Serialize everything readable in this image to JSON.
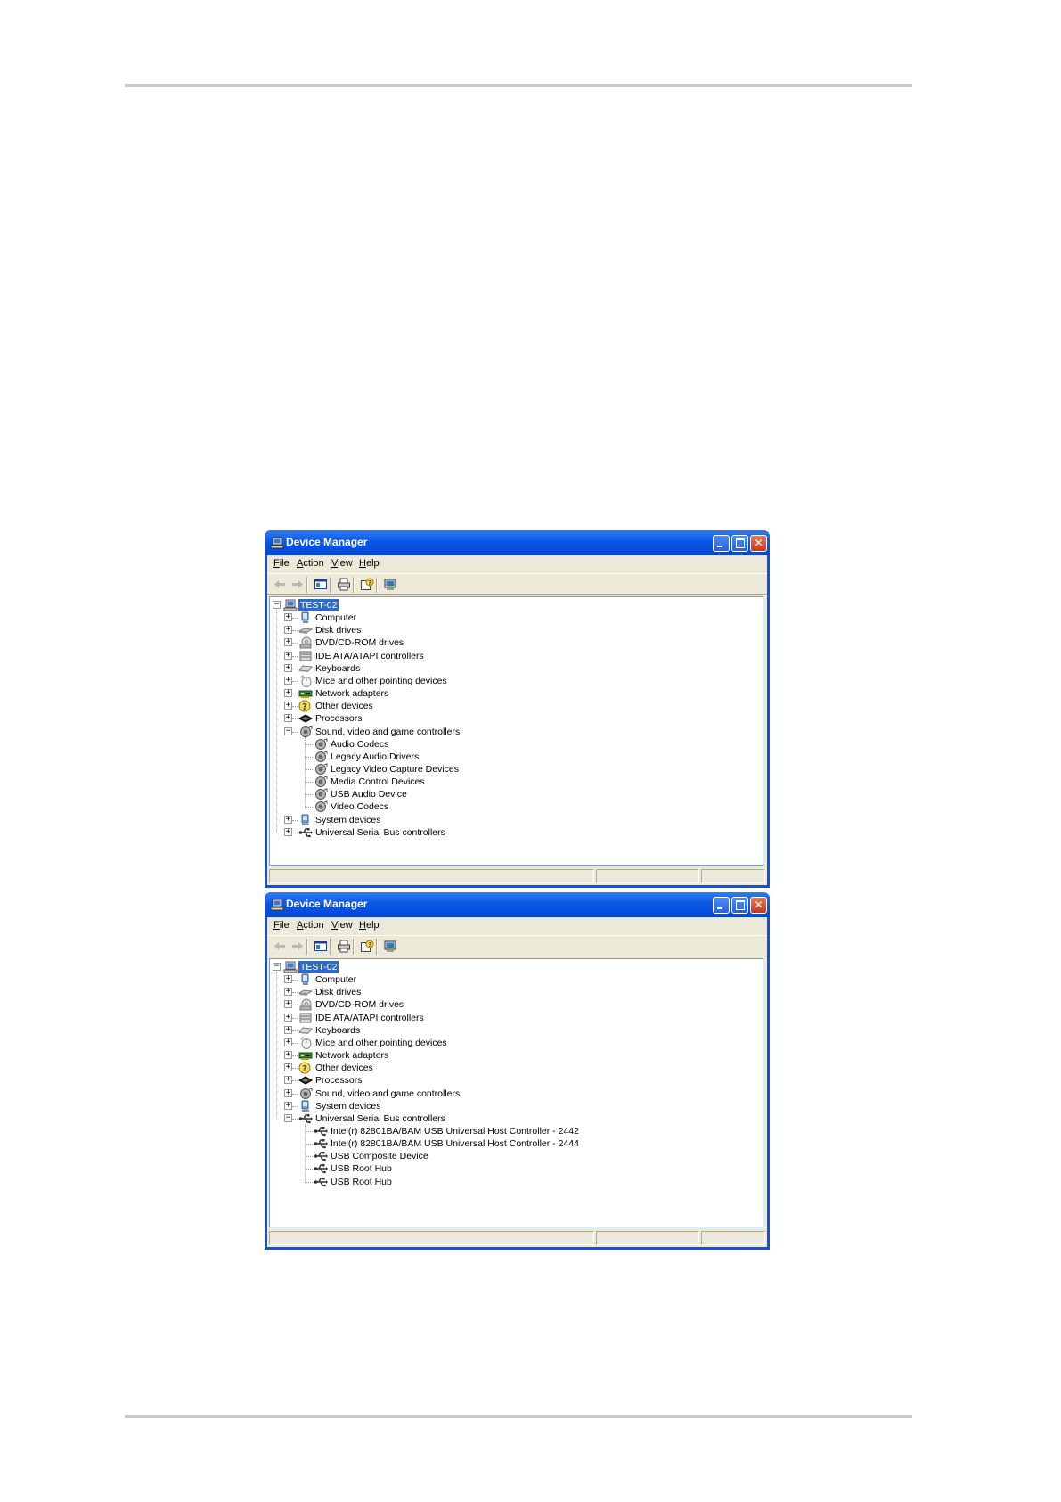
{
  "windows": [
    {
      "title": "Device Manager",
      "menu": [
        {
          "accel": "F",
          "rest": "ile"
        },
        {
          "accel": "A",
          "rest": "ction"
        },
        {
          "accel": "V",
          "rest": "iew"
        },
        {
          "accel": "H",
          "rest": "elp"
        }
      ],
      "toolbar_icons": [
        "back-icon",
        "forward-icon",
        "show-hide-console-tree-icon",
        "print-icon",
        "properties-help-icon",
        "scan-hardware-icon"
      ],
      "root": "TEST-02",
      "categories": [
        {
          "label": "Computer",
          "icon": "computer-icon",
          "expanded": false
        },
        {
          "label": "Disk drives",
          "icon": "disk-drive-icon",
          "expanded": false
        },
        {
          "label": "DVD/CD-ROM drives",
          "icon": "cdrom-icon",
          "expanded": false
        },
        {
          "label": "IDE ATA/ATAPI controllers",
          "icon": "ide-controller-icon",
          "expanded": false
        },
        {
          "label": "Keyboards",
          "icon": "keyboard-icon",
          "expanded": false
        },
        {
          "label": "Mice and other pointing devices",
          "icon": "mouse-icon",
          "expanded": false
        },
        {
          "label": "Network adapters",
          "icon": "network-adapter-icon",
          "expanded": false
        },
        {
          "label": "Other devices",
          "icon": "unknown-device-icon",
          "expanded": false
        },
        {
          "label": "Processors",
          "icon": "processor-icon",
          "expanded": false
        },
        {
          "label": "Sound, video and game controllers",
          "icon": "sound-icon",
          "expanded": true,
          "children": [
            {
              "label": "Audio Codecs",
              "icon": "sound-icon"
            },
            {
              "label": "Legacy Audio Drivers",
              "icon": "sound-icon"
            },
            {
              "label": "Legacy Video Capture Devices",
              "icon": "sound-icon"
            },
            {
              "label": "Media Control Devices",
              "icon": "sound-icon"
            },
            {
              "label": "USB Audio Device",
              "icon": "sound-icon"
            },
            {
              "label": "Video Codecs",
              "icon": "sound-icon"
            }
          ]
        },
        {
          "label": "System devices",
          "icon": "system-device-icon",
          "expanded": false
        },
        {
          "label": "Universal Serial Bus controllers",
          "icon": "usb-icon",
          "expanded": false
        }
      ]
    },
    {
      "title": "Device Manager",
      "menu": [
        {
          "accel": "F",
          "rest": "ile"
        },
        {
          "accel": "A",
          "rest": "ction"
        },
        {
          "accel": "V",
          "rest": "iew"
        },
        {
          "accel": "H",
          "rest": "elp"
        }
      ],
      "toolbar_icons": [
        "back-icon",
        "forward-icon",
        "show-hide-console-tree-icon",
        "print-icon",
        "properties-help-icon",
        "scan-hardware-icon"
      ],
      "root": "TEST-02",
      "categories": [
        {
          "label": "Computer",
          "icon": "computer-icon",
          "expanded": false
        },
        {
          "label": "Disk drives",
          "icon": "disk-drive-icon",
          "expanded": false
        },
        {
          "label": "DVD/CD-ROM drives",
          "icon": "cdrom-icon",
          "expanded": false
        },
        {
          "label": "IDE ATA/ATAPI controllers",
          "icon": "ide-controller-icon",
          "expanded": false
        },
        {
          "label": "Keyboards",
          "icon": "keyboard-icon",
          "expanded": false
        },
        {
          "label": "Mice and other pointing devices",
          "icon": "mouse-icon",
          "expanded": false
        },
        {
          "label": "Network adapters",
          "icon": "network-adapter-icon",
          "expanded": false
        },
        {
          "label": "Other devices",
          "icon": "unknown-device-icon",
          "expanded": false
        },
        {
          "label": "Processors",
          "icon": "processor-icon",
          "expanded": false
        },
        {
          "label": "Sound, video and game controllers",
          "icon": "sound-icon",
          "expanded": false
        },
        {
          "label": "System devices",
          "icon": "system-device-icon",
          "expanded": false
        },
        {
          "label": "Universal Serial Bus controllers",
          "icon": "usb-icon",
          "expanded": true,
          "children": [
            {
              "label": "Intel(r) 82801BA/BAM USB Universal Host Controller - 2442",
              "icon": "usb-icon"
            },
            {
              "label": "Intel(r) 82801BA/BAM USB Universal Host Controller - 2444",
              "icon": "usb-icon"
            },
            {
              "label": "USB Composite Device",
              "icon": "usb-icon"
            },
            {
              "label": "USB Root Hub",
              "icon": "usb-icon"
            },
            {
              "label": "USB Root Hub",
              "icon": "usb-icon"
            }
          ]
        }
      ]
    }
  ]
}
